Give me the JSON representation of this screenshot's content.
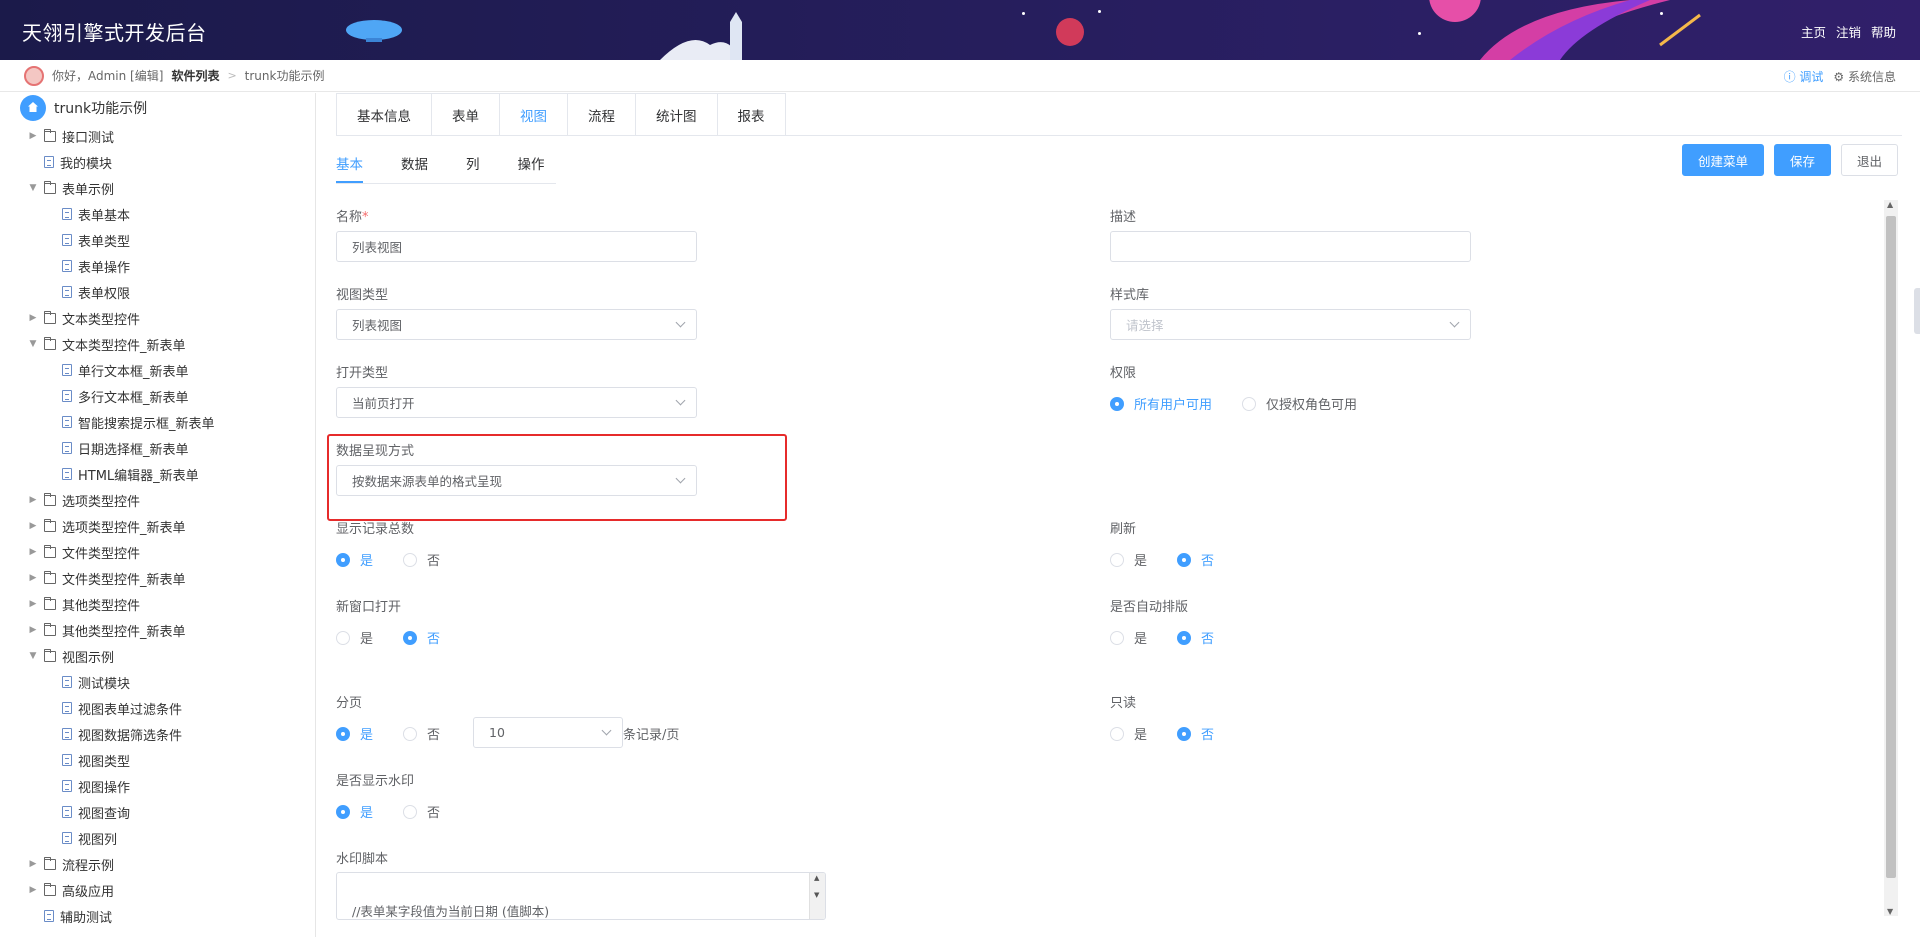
{
  "header": {
    "title": "天翎引擎式开发后台",
    "links": [
      "主页",
      "注销",
      "帮助"
    ]
  },
  "breadcrumb": {
    "greeting": "你好，Admin [编辑]",
    "software_list": "软件列表",
    "separator": ">",
    "current": "trunk功能示例",
    "debug": "调试",
    "system_info": "系统信息"
  },
  "sidebar": {
    "root": "trunk功能示例",
    "items": [
      {
        "label": "接口测试",
        "type": "folder",
        "level": 0,
        "expand": "collapsed"
      },
      {
        "label": "我的模块",
        "type": "file",
        "level": 0,
        "expand": "none"
      },
      {
        "label": "表单示例",
        "type": "folder",
        "level": 0,
        "expand": "expanded"
      },
      {
        "label": "表单基本",
        "type": "file",
        "level": 1,
        "expand": "none"
      },
      {
        "label": "表单类型",
        "type": "file",
        "level": 1,
        "expand": "none"
      },
      {
        "label": "表单操作",
        "type": "file",
        "level": 1,
        "expand": "none"
      },
      {
        "label": "表单权限",
        "type": "file",
        "level": 1,
        "expand": "none"
      },
      {
        "label": "文本类型控件",
        "type": "folder",
        "level": 0,
        "expand": "collapsed"
      },
      {
        "label": "文本类型控件_新表单",
        "type": "folder",
        "level": 0,
        "expand": "expanded"
      },
      {
        "label": "单行文本框_新表单",
        "type": "file",
        "level": 1,
        "expand": "none"
      },
      {
        "label": "多行文本框_新表单",
        "type": "file",
        "level": 1,
        "expand": "none"
      },
      {
        "label": "智能搜索提示框_新表单",
        "type": "file",
        "level": 1,
        "expand": "none"
      },
      {
        "label": "日期选择框_新表单",
        "type": "file",
        "level": 1,
        "expand": "none"
      },
      {
        "label": "HTML编辑器_新表单",
        "type": "file",
        "level": 1,
        "expand": "none"
      },
      {
        "label": "选项类型控件",
        "type": "folder",
        "level": 0,
        "expand": "collapsed"
      },
      {
        "label": "选项类型控件_新表单",
        "type": "folder",
        "level": 0,
        "expand": "collapsed"
      },
      {
        "label": "文件类型控件",
        "type": "folder",
        "level": 0,
        "expand": "collapsed"
      },
      {
        "label": "文件类型控件_新表单",
        "type": "folder",
        "level": 0,
        "expand": "collapsed"
      },
      {
        "label": "其他类型控件",
        "type": "folder",
        "level": 0,
        "expand": "collapsed"
      },
      {
        "label": "其他类型控件_新表单",
        "type": "folder",
        "level": 0,
        "expand": "collapsed"
      },
      {
        "label": "视图示例",
        "type": "folder",
        "level": 0,
        "expand": "expanded"
      },
      {
        "label": "测试模块",
        "type": "file",
        "level": 1,
        "expand": "none"
      },
      {
        "label": "视图表单过滤条件",
        "type": "file",
        "level": 1,
        "expand": "none"
      },
      {
        "label": "视图数据筛选条件",
        "type": "file",
        "level": 1,
        "expand": "none"
      },
      {
        "label": "视图类型",
        "type": "file",
        "level": 1,
        "expand": "none"
      },
      {
        "label": "视图操作",
        "type": "file",
        "level": 1,
        "expand": "none"
      },
      {
        "label": "视图查询",
        "type": "file",
        "level": 1,
        "expand": "none"
      },
      {
        "label": "视图列",
        "type": "file",
        "level": 1,
        "expand": "none"
      },
      {
        "label": "流程示例",
        "type": "folder",
        "level": 0,
        "expand": "collapsed"
      },
      {
        "label": "高级应用",
        "type": "folder",
        "level": 0,
        "expand": "collapsed"
      },
      {
        "label": "辅助测试",
        "type": "file",
        "level": 0,
        "expand": "none"
      }
    ]
  },
  "main_tabs": [
    {
      "label": "基本信息",
      "active": false
    },
    {
      "label": "表单",
      "active": false
    },
    {
      "label": "视图",
      "active": true
    },
    {
      "label": "流程",
      "active": false
    },
    {
      "label": "统计图",
      "active": false
    },
    {
      "label": "报表",
      "active": false
    }
  ],
  "sub_tabs": [
    {
      "label": "基本",
      "active": true
    },
    {
      "label": "数据",
      "active": false
    },
    {
      "label": "列",
      "active": false
    },
    {
      "label": "操作",
      "active": false
    }
  ],
  "actions": {
    "create_menu": "创建菜单",
    "save": "保存",
    "exit": "退出"
  },
  "form": {
    "name_label": "名称",
    "required_mark": "*",
    "name_value": "列表视图",
    "desc_label": "描述",
    "desc_value": "",
    "view_type_label": "视图类型",
    "view_type_value": "列表视图",
    "style_lib_label": "样式库",
    "style_lib_placeholder": "请选择",
    "open_type_label": "打开类型",
    "open_type_value": "当前页打开",
    "permission_label": "权限",
    "permission_opt_all": "所有用户可用",
    "permission_opt_role": "仅授权角色可用",
    "permission_selected": "all",
    "data_display_label": "数据呈现方式",
    "data_display_value": "按数据来源表单的格式呈现",
    "show_total_label": "显示记录总数",
    "refresh_label": "刷新",
    "new_window_label": "新窗口打开",
    "auto_layout_label": "是否自动排版",
    "paging_label": "分页",
    "page_size": "10",
    "page_unit": "条记录/页",
    "readonly_label": "只读",
    "watermark_label": "是否显示水印",
    "watermark_script_label": "水印脚本",
    "watermark_script_value": "//表单某字段值为当前日期 (值脚本)",
    "yes": "是",
    "no": "否",
    "show_total": "yes",
    "refresh": "no",
    "new_window": "no",
    "auto_layout": "no",
    "paging": "yes",
    "readonly": "no",
    "watermark": "yes"
  },
  "colors": {
    "accent": "#409eff",
    "highlight": "#e62b2b",
    "header_bg": "#231d58"
  }
}
